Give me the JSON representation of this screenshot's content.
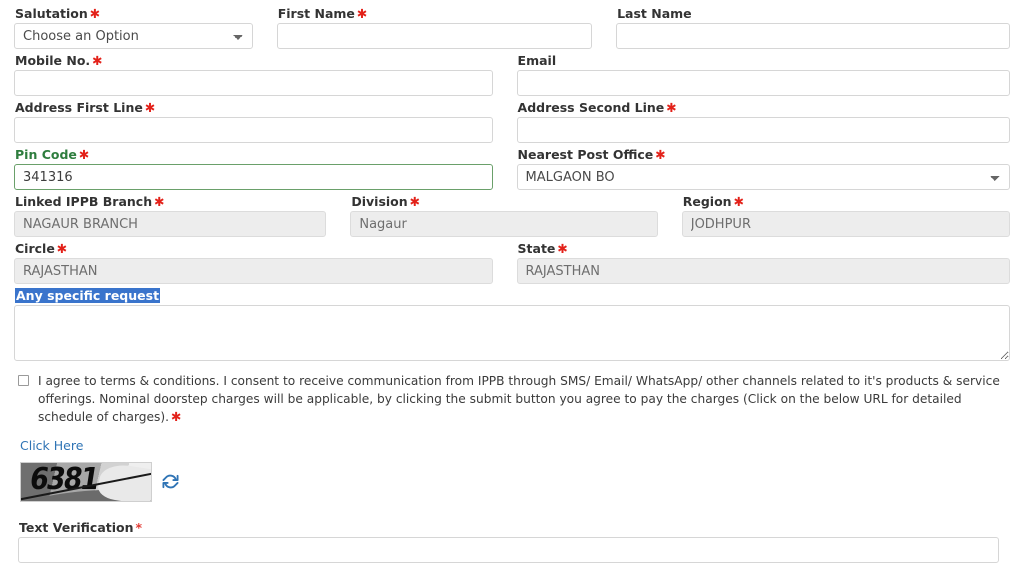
{
  "form": {
    "rows": [
      {
        "fields": [
          {
            "label": "Salutation",
            "required": true,
            "type": "select",
            "value": "Choose an Option",
            "name": "salutation"
          },
          {
            "label": "First Name",
            "required": true,
            "type": "text",
            "value": "",
            "name": "first-name"
          },
          {
            "label": "Last Name",
            "required": false,
            "type": "text",
            "value": "",
            "name": "last-name"
          }
        ]
      },
      {
        "fields": [
          {
            "label": "Mobile No.",
            "required": true,
            "type": "text",
            "value": "",
            "name": "mobile-no"
          },
          {
            "label": "Email",
            "required": false,
            "type": "text",
            "value": "",
            "name": "email"
          }
        ]
      },
      {
        "fields": [
          {
            "label": "Address First Line",
            "required": true,
            "type": "text",
            "value": "",
            "name": "address-first-line"
          },
          {
            "label": "Address Second Line",
            "required": true,
            "type": "text",
            "value": "",
            "name": "address-second-line"
          }
        ]
      },
      {
        "fields": [
          {
            "label": "Pin Code",
            "required": true,
            "type": "text",
            "value": "341316",
            "name": "pin-code",
            "state": "valid"
          },
          {
            "label": "Nearest Post Office",
            "required": true,
            "type": "select",
            "value": "MALGAON BO",
            "name": "nearest-post-office"
          }
        ]
      },
      {
        "fields": [
          {
            "label": "Linked IPPB Branch",
            "required": true,
            "type": "text",
            "value": "NAGAUR BRANCH",
            "name": "linked-ippb-branch",
            "state": "disabled"
          },
          {
            "label": "Division",
            "required": true,
            "type": "text",
            "value": "Nagaur",
            "name": "division",
            "state": "disabled"
          },
          {
            "label": "Region",
            "required": true,
            "type": "text",
            "value": "JODHPUR",
            "name": "region",
            "state": "disabled"
          }
        ]
      },
      {
        "fields": [
          {
            "label": "Circle",
            "required": true,
            "type": "text",
            "value": "RAJASTHAN",
            "name": "circle",
            "state": "disabled"
          },
          {
            "label": "State",
            "required": true,
            "type": "text",
            "value": "RAJASTHAN",
            "name": "state",
            "state": "disabled"
          }
        ]
      }
    ],
    "specific_request": {
      "label": "Any specific request",
      "value": "",
      "highlighted": true
    },
    "consent": {
      "checked": false,
      "text": "I agree to terms & conditions. I consent to receive communication from IPPB through SMS/ Email/ WhatsApp/ other channels related to it's products & service offerings. Nominal doorstep charges will be applicable, by clicking the submit button you agree to pay the charges (Click on the below URL for detailed schedule of charges).",
      "required": true
    },
    "click_here_link": "Click Here",
    "captcha": {
      "text": "6381",
      "refresh_icon": "refresh-icon"
    },
    "text_verification": {
      "label": "Text Verification",
      "required": true,
      "value": ""
    }
  },
  "colors": {
    "required_asterisk": "#e32119",
    "valid_label": "#2e7d3e",
    "selection_highlight": "#3a74cc",
    "link": "#2f74b5",
    "disabled_bg": "#ededed"
  }
}
